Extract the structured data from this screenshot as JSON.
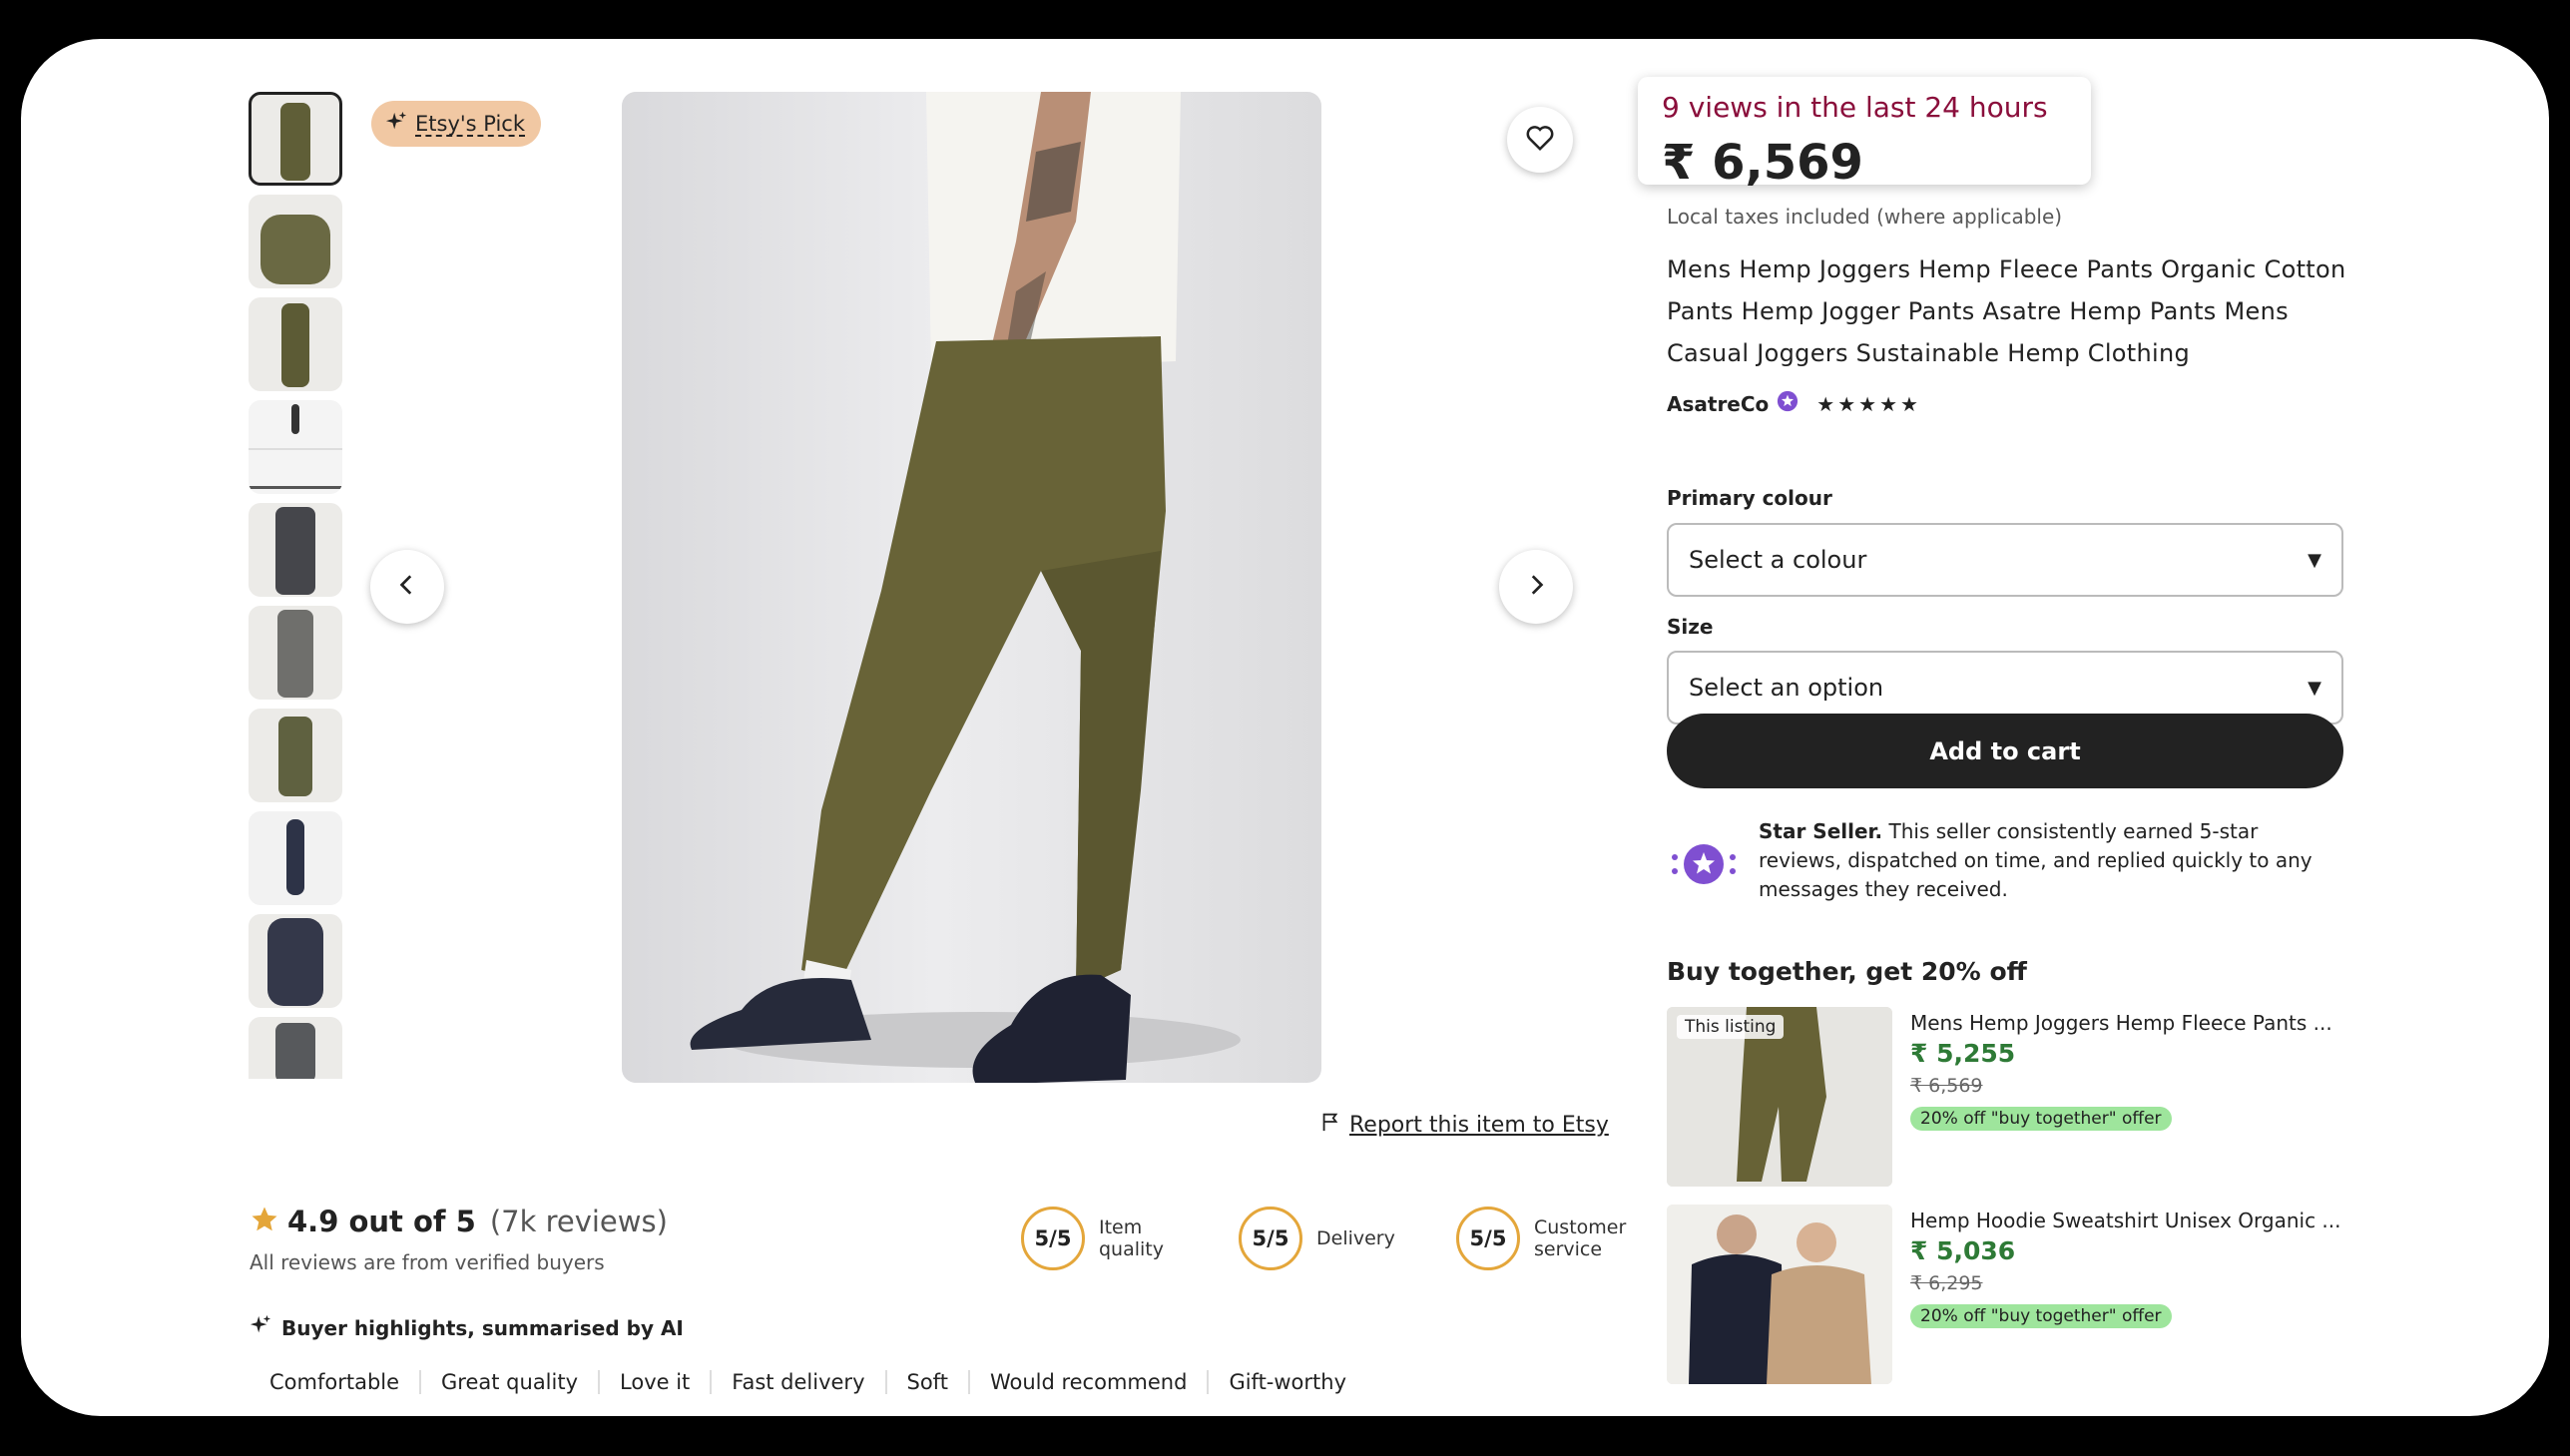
{
  "listing": {
    "etsys_pick": "Etsy's Pick",
    "views": "9 views in the last 24 hours",
    "price": "₹ 6,569",
    "tax_note": "Local taxes included (where applicable)",
    "title": "Mens Hemp Joggers Hemp Fleece Pants Organic Cotton Pants Hemp Jogger Pants Asatre Hemp Pants Mens Casual Joggers Sustainable Hemp Clothing",
    "shop_name": "AsatreCo",
    "stars": "★★★★★",
    "report_link": "Report this item to Etsy"
  },
  "options": {
    "colour_label": "Primary colour",
    "colour_value": "Select a colour",
    "size_label": "Size",
    "size_value": "Select an option",
    "add_to_cart": "Add to cart"
  },
  "star_seller": {
    "title": "Star Seller.",
    "text": "This seller consistently earned 5-star reviews, dispatched on time, and replied quickly to any messages they received."
  },
  "buy_together": {
    "heading": "Buy together, get 20% off",
    "items": [
      {
        "tag": "This listing",
        "name": "Mens Hemp Joggers Hemp Fleece Pants ...",
        "sale_price": "₹ 5,255",
        "original_price": "₹ 6,569",
        "offer": "20% off \"buy together\" offer"
      },
      {
        "name": "Hemp Hoodie Sweatshirt Unisex Organic ...",
        "sale_price": "₹ 5,036",
        "original_price": "₹ 6,295",
        "offer": "20% off \"buy together\" offer"
      }
    ]
  },
  "reviews": {
    "score": "4.9 out of 5",
    "count": "(7k reviews)",
    "verified": "All reviews are from verified buyers",
    "metrics": [
      {
        "score": "5/5",
        "label": "Item\nquality"
      },
      {
        "score": "5/5",
        "label": "Delivery"
      },
      {
        "score": "5/5",
        "label": "Customer\nservice"
      }
    ],
    "highlights_title": "Buyer highlights, summarised by AI",
    "highlights": [
      "Comfortable",
      "Great quality",
      "Love it",
      "Fast delivery",
      "Soft",
      "Would recommend",
      "Gift-worthy"
    ]
  },
  "colors": {
    "views_text": "#8a0e3b",
    "sale_price": "#2e7a36",
    "offer_badge": "#9ee59c",
    "etsys_pick_badge": "#f1c8a3",
    "star_seller_purple": "#7f4fd1",
    "rating_star": "#e4a63a"
  },
  "icons": [
    "sparkle-icon",
    "heart-icon",
    "chevron-left-icon",
    "chevron-right-icon",
    "flag-icon",
    "star-icon",
    "star-seller-badge-icon",
    "dropdown-arrow-icon"
  ]
}
